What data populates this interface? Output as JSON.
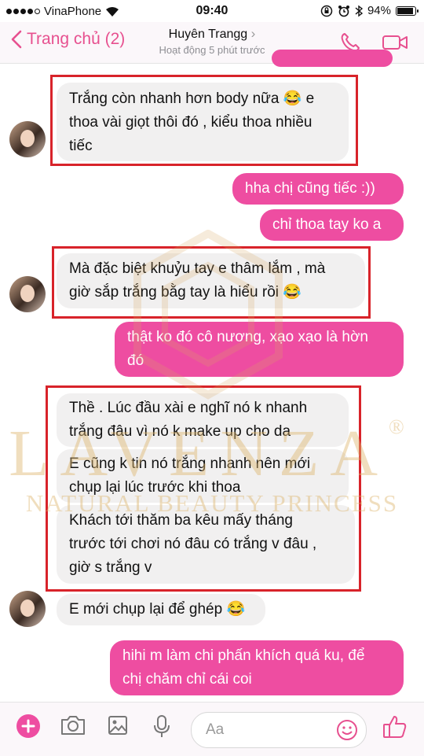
{
  "status_bar": {
    "carrier": "VinaPhone",
    "time": "09:40",
    "battery_percent": "94%",
    "battery_level": 0.94
  },
  "header": {
    "back_label": "Trang chủ (2)",
    "contact_name": "Huyên Trangg",
    "contact_status": "Hoạt động 5 phút trước"
  },
  "messages": [
    {
      "side": "in",
      "lines": [
        "Trắng còn nhanh hơn body nữa 😂 e",
        "thoa vài giọt thôi đó , kiểu thoa nhiều",
        "tiếc"
      ]
    },
    {
      "side": "out",
      "lines": [
        "hha chị cũng tiếc :))"
      ]
    },
    {
      "side": "out",
      "lines": [
        "chỉ thoa tay ko a"
      ]
    },
    {
      "side": "in",
      "lines": [
        "Mà đặc biệt khuỷu tay e thâm lắm , mà",
        "giờ sắp trắng bằg tay là hiểu rồi 😂"
      ]
    },
    {
      "side": "out",
      "lines": [
        "thật ko đó cô nương, xạo xạo là hờn",
        "đó"
      ]
    },
    {
      "side": "in",
      "lines": [
        "Thề . Lúc đầu xài e nghĩ nó k nhanh",
        "trắng đâu vì nó k make up cho da"
      ]
    },
    {
      "side": "in",
      "lines": [
        "E cũng k tin nó trắng nhanh nên mới",
        "chụp lại lúc trước khi thoa"
      ]
    },
    {
      "side": "in",
      "lines": [
        "Khách tới thăm ba kêu mấy tháng",
        "trước tới chơi nó đâu có trắng v đâu ,",
        "giờ s trắng v"
      ]
    },
    {
      "side": "in",
      "lines": [
        "E mới chụp lại để ghép 😂"
      ]
    },
    {
      "side": "out",
      "lines": [
        "hihi m làm chi phấn khích quá ku, để",
        "chị chăm chỉ cái coi"
      ]
    }
  ],
  "composer": {
    "placeholder": "Aa"
  },
  "watermark": {
    "brand": "LAVENZA",
    "registered": "®",
    "tagline": "NATURAL BEAUTY PRINCESS"
  },
  "colors": {
    "accent": "#e7508f",
    "outgoing_bubble": "#ee4da1",
    "incoming_bubble": "#f1f0f0",
    "highlight_frame": "#d8232a"
  }
}
